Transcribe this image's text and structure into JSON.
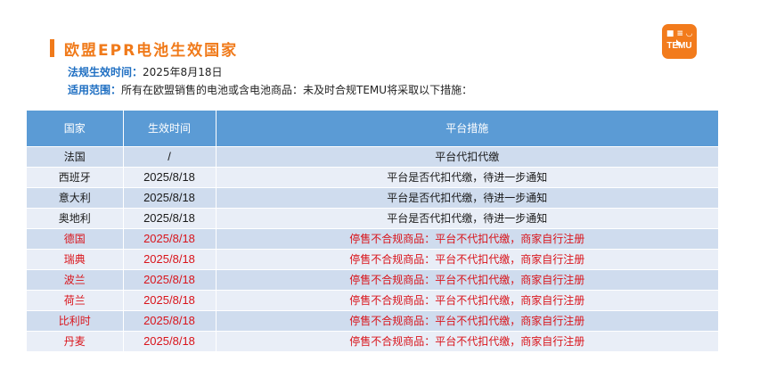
{
  "slide": {
    "title": "欧盟EPR电池生效国家",
    "logo": {
      "glyphs": "■ ≡ ◡ ◣",
      "word": "TEMU"
    },
    "effective": {
      "label": "法规生效时间：",
      "value": "2025年8月18日"
    },
    "scope": {
      "label": "适用范围：",
      "value": "所有在欧盟销售的电池或含电池商品：未及时合规TEMU将采取以下措施："
    }
  },
  "table": {
    "headers": [
      "国家",
      "生效时间",
      "平台措施"
    ],
    "rows": [
      {
        "country": "法国",
        "date": "/",
        "measure": "平台代扣代缴",
        "restricted": false
      },
      {
        "country": "西班牙",
        "date": "2025/8/18",
        "measure": "平台是否代扣代缴，待进一步通知",
        "restricted": false
      },
      {
        "country": "意大利",
        "date": "2025/8/18",
        "measure": "平台是否代扣代缴，待进一步通知",
        "restricted": false
      },
      {
        "country": "奥地利",
        "date": "2025/8/18",
        "measure": "平台是否代扣代缴，待进一步通知",
        "restricted": false
      },
      {
        "country": "德国",
        "date": "2025/8/18",
        "measure": "停售不合规商品：平台不代扣代缴，商家自行注册",
        "restricted": true
      },
      {
        "country": "瑞典",
        "date": "2025/8/18",
        "measure": "停售不合规商品：平台不代扣代缴，商家自行注册",
        "restricted": true
      },
      {
        "country": "波兰",
        "date": "2025/8/18",
        "measure": "停售不合规商品：平台不代扣代缴，商家自行注册",
        "restricted": true
      },
      {
        "country": "荷兰",
        "date": "2025/8/18",
        "measure": "停售不合规商品：平台不代扣代缴，商家自行注册",
        "restricted": true
      },
      {
        "country": "比利时",
        "date": "2025/8/18",
        "measure": "停售不合规商品：平台不代扣代缴，商家自行注册",
        "restricted": true
      },
      {
        "country": "丹麦",
        "date": "2025/8/18",
        "measure": "停售不合规商品：平台不代扣代缴，商家自行注册",
        "restricted": true
      }
    ]
  },
  "colors": {
    "accent": "#f07a1a",
    "label_blue": "#1f6fc2",
    "header_blue": "#5b9bd5",
    "row_a": "#cfdcee",
    "row_b": "#e9eef7",
    "restricted_red": "#d9141b"
  }
}
